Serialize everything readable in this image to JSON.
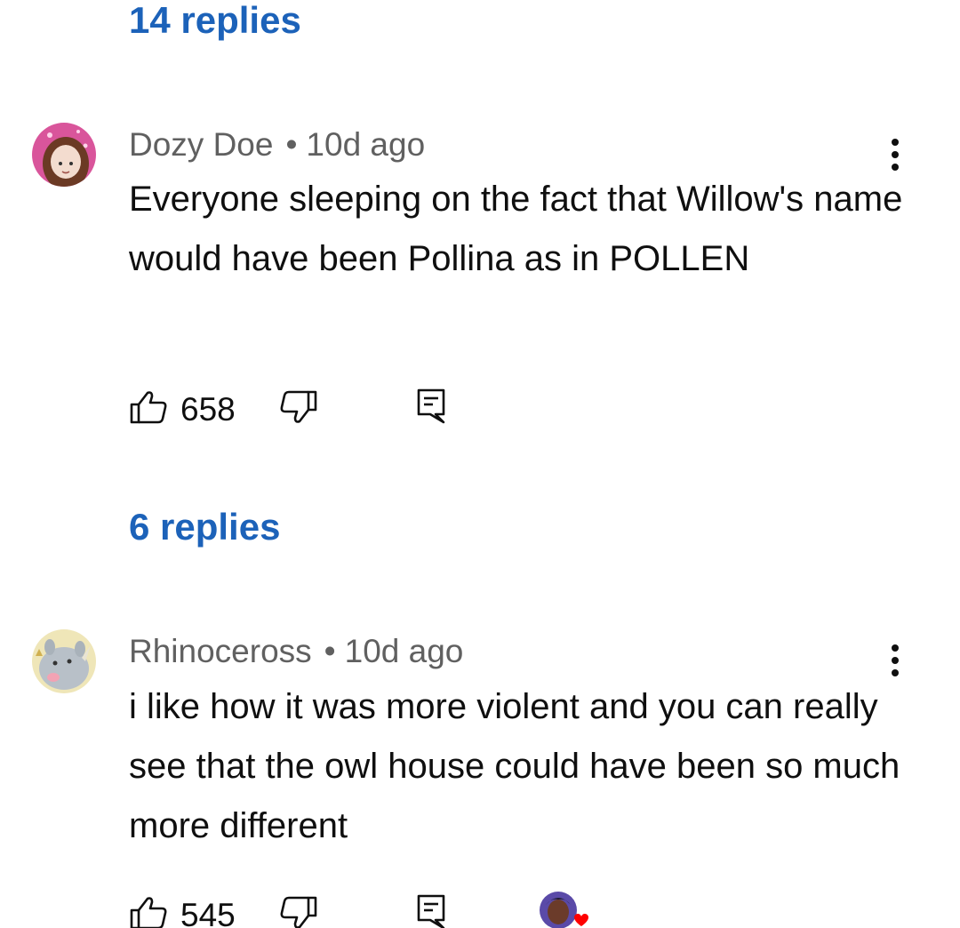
{
  "thread_top": {
    "replies_label": "14 replies"
  },
  "comments": [
    {
      "author": "Dozy Doe",
      "separator": "•",
      "time": "10d ago",
      "text": "Everyone sleeping on the fact that Willow's name would have been Pollina as in POLLEN",
      "likes": "658",
      "replies_label": "6 replies"
    },
    {
      "author": "Rhinoceross",
      "separator": "•",
      "time": "10d ago",
      "text": "i like how it was more violent and you can really see that the owl house could have been so much more different",
      "likes": "545"
    }
  ],
  "icons": {
    "like": "thumbs-up-icon",
    "dislike": "thumbs-down-icon",
    "reply": "reply-icon",
    "menu": "more-vert-icon"
  },
  "colors": {
    "link": "#1c62b9",
    "meta": "#606060",
    "text": "#0f0f0f",
    "heart": "#ff0000"
  }
}
